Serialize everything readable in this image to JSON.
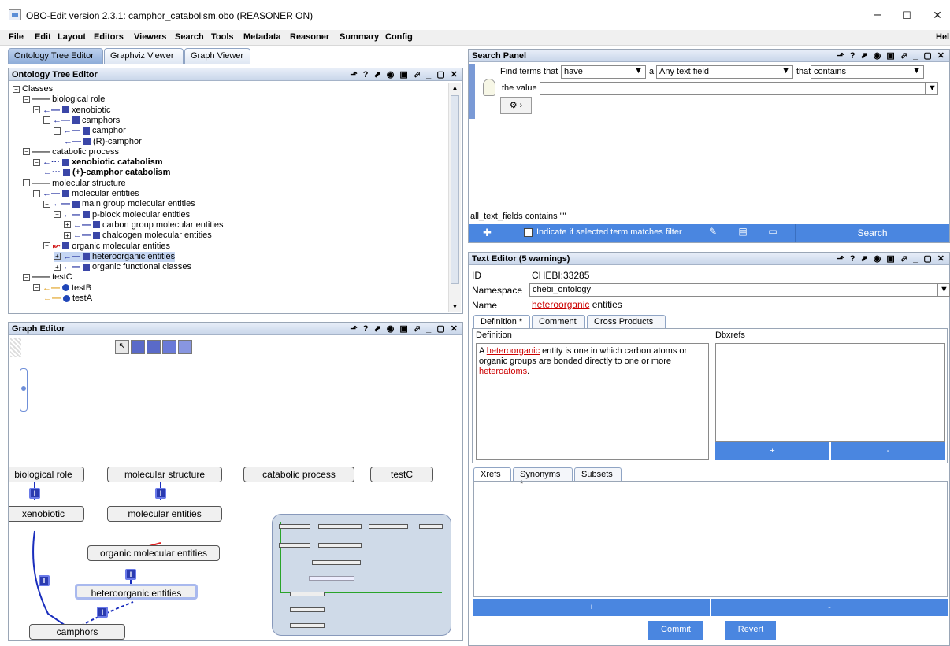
{
  "window": {
    "title": "OBO-Edit version 2.3.1: camphor_catabolism.obo (REASONER ON)",
    "min": "–",
    "max": "☐",
    "close": "✕"
  },
  "menu": [
    "File",
    "Edit",
    "Layout",
    "Editors",
    "Viewers",
    "Search",
    "Tools",
    "Metadata",
    "Reasoner",
    "Summary",
    "Config"
  ],
  "menu_help": "Hel",
  "tabs": [
    "Ontology Tree Editor",
    "Graphviz Viewer",
    "Graph Viewer"
  ],
  "tree_panel": {
    "title": "Ontology Tree Editor",
    "rows": [
      {
        "label": "Classes",
        "indent": 0,
        "toggle": "⊟",
        "kind": "root"
      },
      {
        "label": "biological role",
        "indent": 1,
        "toggle": "⊟",
        "kind": "plain"
      },
      {
        "label": "xenobiotic",
        "indent": 2,
        "toggle": "⊟",
        "kind": "i"
      },
      {
        "label": "camphors",
        "indent": 3,
        "toggle": "⊟",
        "kind": "i"
      },
      {
        "label": "camphor",
        "indent": 4,
        "toggle": "⊟",
        "kind": "i"
      },
      {
        "label": "(R)-camphor",
        "indent": 5,
        "toggle": "",
        "kind": "i"
      },
      {
        "label": "catabolic process",
        "indent": 1,
        "toggle": "⊟",
        "kind": "plain"
      },
      {
        "label": "xenobiotic catabolism",
        "indent": 2,
        "toggle": "⊟",
        "kind": "idot",
        "bold": true
      },
      {
        "label": "(+)-camphor catabolism",
        "indent": 3,
        "toggle": "",
        "kind": "idot",
        "bold": true
      },
      {
        "label": "molecular structure",
        "indent": 1,
        "toggle": "⊟",
        "kind": "plain"
      },
      {
        "label": "molecular entities",
        "indent": 2,
        "toggle": "⊟",
        "kind": "i"
      },
      {
        "label": "main group molecular entities",
        "indent": 3,
        "toggle": "⊟",
        "kind": "i"
      },
      {
        "label": "p-block molecular entities",
        "indent": 4,
        "toggle": "⊟",
        "kind": "i"
      },
      {
        "label": "carbon group molecular entities",
        "indent": 5,
        "toggle": "⊞",
        "kind": "i"
      },
      {
        "label": "chalcogen molecular entities",
        "indent": 5,
        "toggle": "⊞",
        "kind": "i"
      },
      {
        "label": "organic molecular entities",
        "indent": 3,
        "toggle": "⊟",
        "kind": "red"
      },
      {
        "label": "heteroorganic entities",
        "indent": 4,
        "toggle": "⊞",
        "kind": "i",
        "selected": true
      },
      {
        "label": "organic functional classes",
        "indent": 4,
        "toggle": "⊞",
        "kind": "i"
      },
      {
        "label": "testC",
        "indent": 1,
        "toggle": "⊟",
        "kind": "plain"
      },
      {
        "label": "testB",
        "indent": 2,
        "toggle": "⊟",
        "kind": "o"
      },
      {
        "label": "testA",
        "indent": 3,
        "toggle": "",
        "kind": "o"
      }
    ],
    "controls": "⬏ ? ⬈ ◉ ▣ ⬀ _ ▢ ✕"
  },
  "graph_panel": {
    "title": "Graph Editor",
    "nodes": {
      "bio": "biological role",
      "mol": "molecular structure",
      "cat": "catabolic process",
      "testc": "testC",
      "xeno": "xenobiotic",
      "molent": "molecular entities",
      "org": "organic molecular entities",
      "hetero": "heteroorganic entities",
      "camph": "camphors"
    },
    "badge": "I"
  },
  "search_panel": {
    "title": "Search Panel",
    "find_label": "Find terms that",
    "have": "have",
    "a_label": "a",
    "field": "Any text field",
    "that_label": "that",
    "op": "contains",
    "value_label": "the value",
    "value": "",
    "filter_summary": "all_text_fields contains \"\"",
    "indicate_label": "Indicate if selected term matches filter",
    "search_button": "Search"
  },
  "text_editor": {
    "title": "Text Editor (5 warnings)",
    "id_label": "ID",
    "id_value": "CHEBI:33285",
    "ns_label": "Namespace",
    "ns_value": "chebi_ontology",
    "name_label": "Name",
    "name_link": "heteroorganic",
    "name_rest": " entities",
    "tabs": [
      "Definition *",
      "Comment",
      "Cross Products"
    ],
    "def_label": "Definition",
    "def_a": "A ",
    "def_link1": "heteroorganic",
    "def_mid": " entity is one in which carbon atoms or organic groups are bonded directly to one or more ",
    "def_link2": "heteroatoms",
    "def_end": ".",
    "dbx_label": "Dbxrefs",
    "plus": "+",
    "minus": "-",
    "tabs2": [
      "Xrefs",
      "Synonyms *",
      "Subsets"
    ],
    "commit": "Commit",
    "revert": "Revert"
  }
}
